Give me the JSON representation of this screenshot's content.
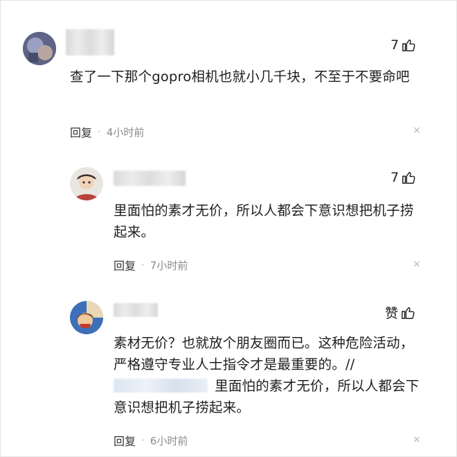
{
  "comments": [
    {
      "likes": "7",
      "text": "查了一下那个gopro相机也就小几千块，不至于不要命吧",
      "reply_label": "回复",
      "separator": "·",
      "time": "4小时前",
      "close_glyph": "×"
    },
    {
      "likes": "7",
      "text": "里面怕的素才无价，所以人都会下意识想把机子捞起来。",
      "reply_label": "回复",
      "separator": "·",
      "time": "7小时前",
      "close_glyph": "×"
    },
    {
      "likes": "赞",
      "text": "素材无价？也就放个朋友圈而已。这种危险活动，严格遵守专业人士指令才是最重要的。//",
      "quote": "里面怕的素才无价，所以人都会下意识想把机子捞起来。",
      "reply_label": "回复",
      "separator": "·",
      "time": "6小时前",
      "close_glyph": "×"
    }
  ]
}
